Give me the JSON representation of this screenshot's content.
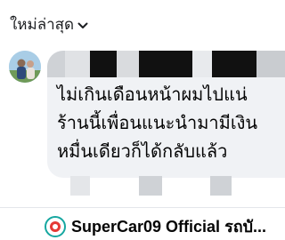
{
  "header": {
    "sort_label": "ใหม่ล่าสุด",
    "chevron_icon": "chevron-down-icon"
  },
  "comment": {
    "avatar_icon": "user-avatar-photo",
    "author_redacted": true,
    "text": "ไม่เกินเดือนหน้าผมไปแน่\nร้านนี้เพื่อนแนะนำมามีเงิน\nหมื่นเดียวก็ได้กลับแล้ว",
    "bubble_color": "#f0f2f5"
  },
  "footer": {
    "page_logo_icon": "page-logo-icon",
    "page_name": "SuperCar09 Official รถบั..."
  },
  "colors": {
    "accent": "#16a7a0",
    "text": "#050505",
    "redaction": "#111111"
  }
}
